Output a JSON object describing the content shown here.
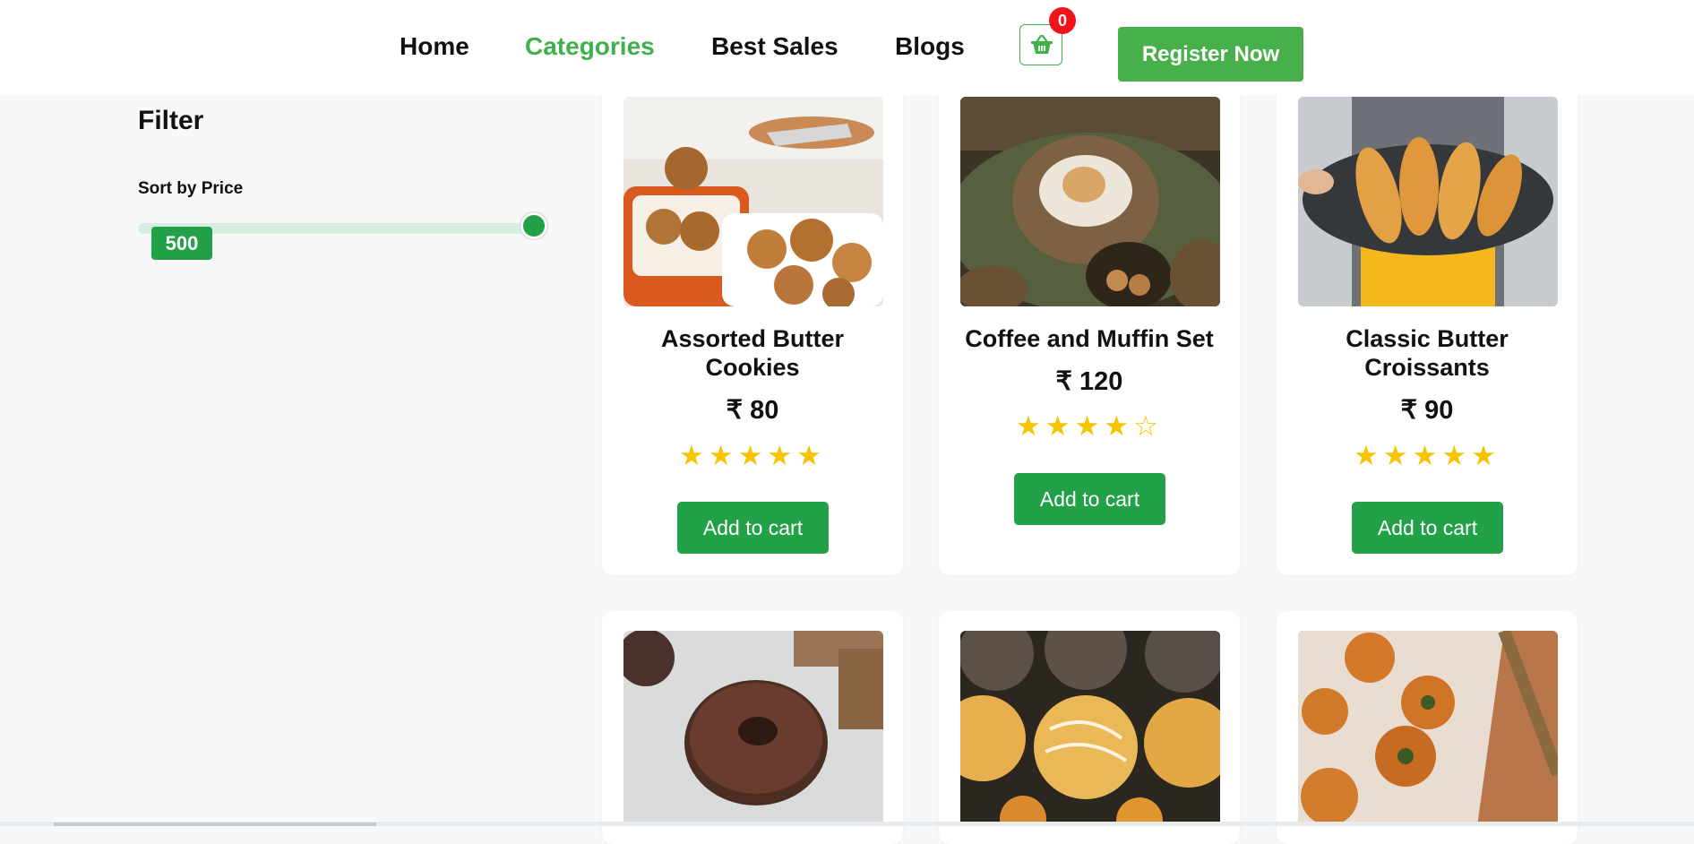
{
  "nav": {
    "items": [
      {
        "label": "Home"
      },
      {
        "label": "Categories",
        "active": true
      },
      {
        "label": "Best Sales"
      },
      {
        "label": "Blogs"
      }
    ],
    "cart_count": "0",
    "register_label": "Register Now"
  },
  "filter": {
    "title": "Filter",
    "sort_label": "Sort by Price",
    "price_value": "500",
    "slider_level": 1.0
  },
  "products": [
    {
      "title": "Assorted Butter Cookies",
      "price": "₹ 80",
      "rating": 5,
      "stars": "★★★★★",
      "button": "Add to cart"
    },
    {
      "title": "Coffee and Muffin Set",
      "price": "₹ 120",
      "rating": 4,
      "stars": "★★★★☆",
      "button": "Add to cart"
    },
    {
      "title": "Classic Butter Croissants",
      "price": "₹ 90",
      "rating": 5,
      "stars": "★★★★★",
      "button": "Add to cart"
    }
  ],
  "colors": {
    "accent": "#40b04a",
    "button_green": "#22a148",
    "badge_red": "#f0131a",
    "star_yellow": "#f7c500"
  }
}
